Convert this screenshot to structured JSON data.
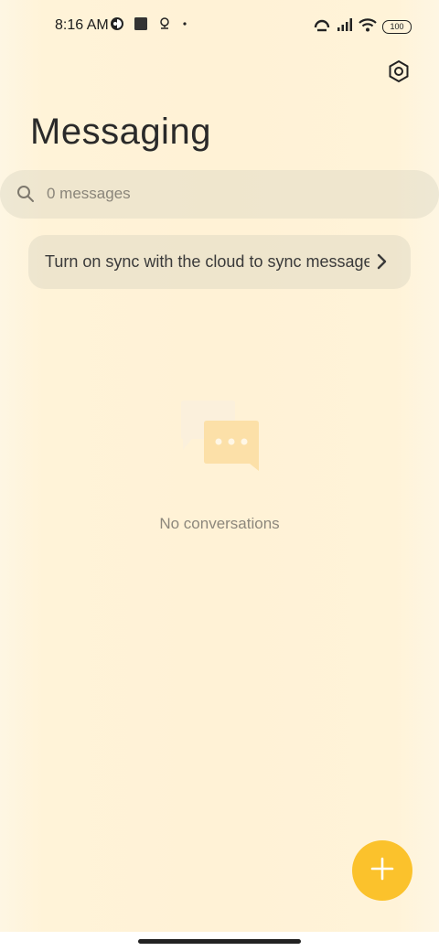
{
  "status_bar": {
    "time": "8:16 AM",
    "battery": "100",
    "icons_left": [
      "app-status-icon",
      "square-icon",
      "location-icon",
      "dot-icon"
    ],
    "icons_right": [
      "hotspot-icon",
      "signal-icon",
      "wifi-icon",
      "battery-icon"
    ]
  },
  "header": {
    "title": "Messaging",
    "settings_icon": "settings-hex-icon"
  },
  "search": {
    "placeholder": "0 messages"
  },
  "sync_banner": {
    "text": "Turn on sync with the cloud to sync messages"
  },
  "empty_state": {
    "text": "No conversations",
    "illustration": "chat-bubbles-icon"
  },
  "fab": {
    "icon": "plus-icon",
    "color": "#fbc22c"
  },
  "colors": {
    "background": "#fff2d6",
    "accent": "#fbc22c"
  }
}
